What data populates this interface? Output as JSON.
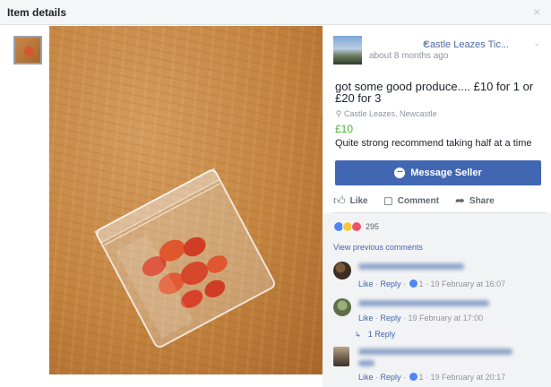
{
  "header": {
    "title": "Item details",
    "close_glyph": "×"
  },
  "post": {
    "seller": "Castle Leazes Tic...",
    "time": "about 8 months ago",
    "title": "got some good produce.... £10 for 1 or £20 for 3",
    "location": "Castle Leazes, Newcastle",
    "price": "£10",
    "description": "Quite strong recommend taking half at a time",
    "message_button": "Message Seller"
  },
  "actions": {
    "like": "Like",
    "comment": "Comment",
    "share": "Share"
  },
  "reactions": {
    "count": "295",
    "types": [
      "like",
      "haha",
      "love"
    ]
  },
  "comments": {
    "view_previous": "View previous comments",
    "items": [
      {
        "like": "Like",
        "reply": "Reply",
        "likes": "1",
        "time": "19 February at 16:07"
      },
      {
        "like": "Like",
        "reply": "Reply",
        "time": "19 February at 17:00",
        "replies": "1 Reply"
      },
      {
        "like": "Like",
        "reply": "Reply",
        "likes": "1",
        "time": "19 February at 20:17"
      }
    ]
  },
  "colors": {
    "brand": "#4267b2",
    "price": "#42b72a",
    "link": "#4b67a1"
  },
  "icons": [
    "close-icon",
    "map-pin-icon",
    "messenger-icon",
    "thumbs-up-icon",
    "comment-icon",
    "share-icon",
    "like-reaction-icon",
    "haha-reaction-icon",
    "love-reaction-icon",
    "reply-arrow-icon"
  ]
}
